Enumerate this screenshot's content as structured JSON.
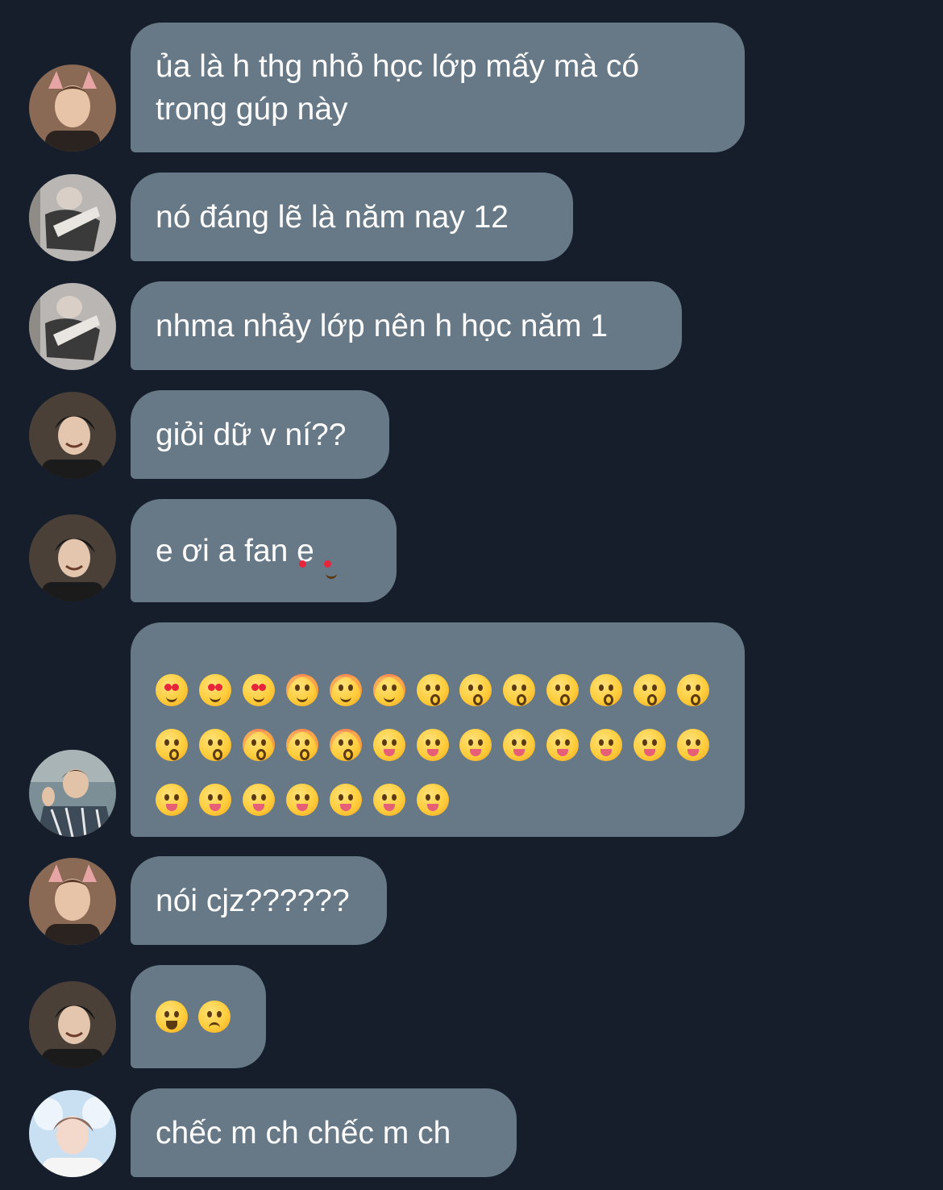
{
  "colors": {
    "background": "#151e2a",
    "bubble": "#677886",
    "text": "#ffffff"
  },
  "messages": [
    {
      "avatar": "avatar-cat-ears",
      "text": "ủa là h thg nhỏ học lớp mấy mà có\ntrong gúp này"
    },
    {
      "avatar": "avatar-dark-outfit",
      "text": "nó đáng lẽ là năm nay 12"
    },
    {
      "avatar": "avatar-dark-outfit",
      "text": "nhma nhảy lớp nên h học năm 1"
    },
    {
      "avatar": "avatar-smiling-black-hair",
      "text": "giỏi dữ v ní??"
    },
    {
      "avatar": "avatar-smiling-black-hair",
      "text": "e ơi a fan e",
      "trailing_emoji": "star-struck"
    },
    {
      "avatar": "avatar-waving-plaid",
      "emoji_rows": [
        [
          "heart-eyes",
          "heart-eyes",
          "heart-eyes",
          "smiling-hearts",
          "smiling-hearts",
          "smiling-hearts",
          "kiss-heart",
          "kiss-heart",
          "kiss-heart",
          "kissing",
          "kissing",
          "kissing",
          "kissing-smiling-eyes"
        ],
        [
          "kissing-smiling-eyes",
          "kissing-smiling-eyes",
          "kissing-closed-eyes",
          "kissing-closed-eyes",
          "kissing-closed-eyes",
          "yum",
          "yum",
          "yum",
          "tongue",
          "tongue",
          "tongue",
          "squint-tongue",
          "squint-tongue"
        ],
        [
          "squint-tongue",
          "wink-tongue",
          "wink-tongue",
          "wink-tongue",
          "zany",
          "zany",
          "zany"
        ]
      ]
    },
    {
      "avatar": "avatar-cat-ears",
      "text": "nói cjz??????"
    },
    {
      "avatar": "avatar-smiling-black-hair",
      "emoji_inline": [
        "grinning",
        "worried"
      ]
    },
    {
      "avatar": "avatar-blue-bunny",
      "text": "chếc m ch chếc m ch"
    }
  ]
}
